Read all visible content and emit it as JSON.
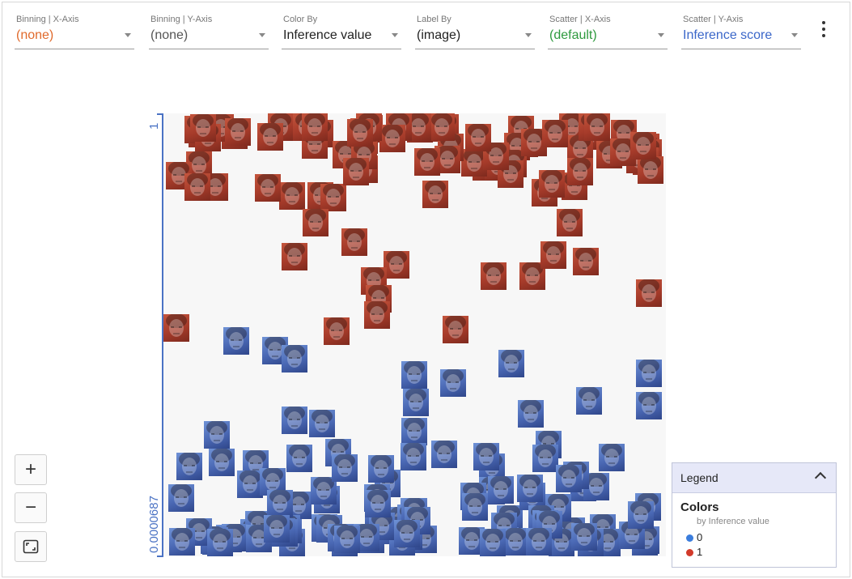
{
  "toolbar": {
    "dropdowns": [
      {
        "label": "Binning | X-Axis",
        "value": "(none)",
        "value_color": "#e06a2c"
      },
      {
        "label": "Binning | Y-Axis",
        "value": "(none)",
        "value_color": "#555555"
      },
      {
        "label": "Color By",
        "value": "Inference value",
        "value_color": "#222222"
      },
      {
        "label": "Label By",
        "value": "(image)",
        "value_color": "#222222"
      },
      {
        "label": "Scatter | X-Axis",
        "value": "(default)",
        "value_color": "#2e9a3e"
      },
      {
        "label": "Scatter | Y-Axis",
        "value": "Inference score",
        "value_color": "#3b67c9"
      }
    ],
    "more_icon": "more-vert-icon"
  },
  "plot": {
    "y_axis_top_label": "1",
    "y_axis_bottom_label": "0.0000687",
    "axis_color": "#4a72c4"
  },
  "zoom_controls": {
    "zoom_in_label": "+",
    "zoom_out_label": "−",
    "fit_icon": "fit-screen-icon"
  },
  "legend": {
    "title": "Legend",
    "section_title": "Colors",
    "section_subtitle": "by Inference value",
    "items": [
      {
        "label": "0",
        "color": "#3b7ddd"
      },
      {
        "label": "1",
        "color": "#d23a2a"
      }
    ]
  }
}
